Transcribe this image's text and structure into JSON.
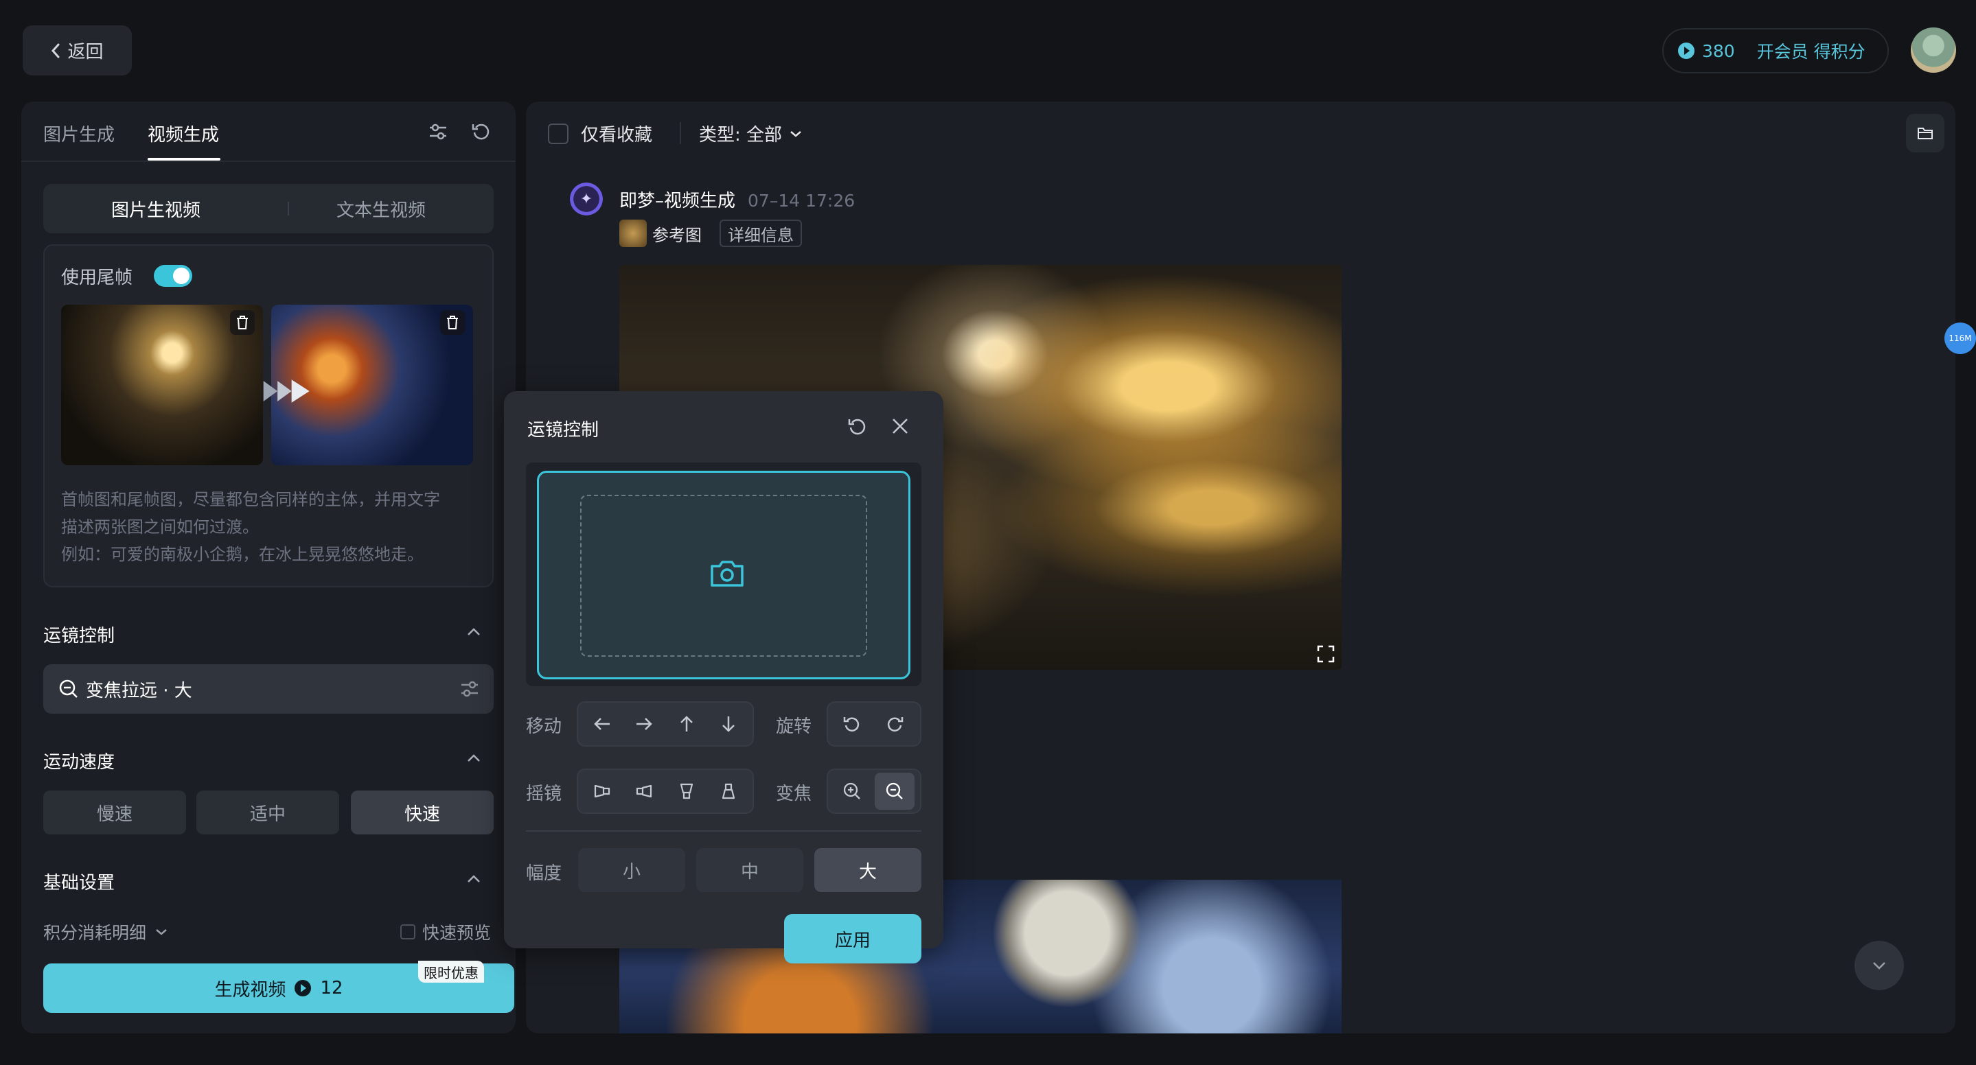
{
  "header": {
    "back_label": "返回",
    "points_value": "380",
    "vip_label": "开会员 得积分"
  },
  "left_panel": {
    "tabs": [
      {
        "label": "图片生成"
      },
      {
        "label": "视频生成"
      }
    ],
    "mode_segments": [
      {
        "label": "图片生视频"
      },
      {
        "label": "文本生视频"
      }
    ],
    "use_last_frame_label": "使用尾帧",
    "use_last_frame_on": true,
    "hint_lines": [
      "首帧图和尾帧图，尽量都包含同样的主体，并用文字",
      "描述两张图之间如何过渡。",
      "例如：可爱的南极小企鹅，在冰上晃晃悠悠地走。"
    ],
    "camera_section_title": "运镜控制",
    "camera_selected": "变焦拉远 · 大",
    "speed_section_title": "运动速度",
    "speed_options": [
      {
        "label": "慢速"
      },
      {
        "label": "适中"
      },
      {
        "label": "快速"
      }
    ],
    "speed_selected": "快速",
    "basic_section_title": "基础设置",
    "cost_detail_label": "积分消耗明细",
    "fast_preview_label": "快速预览",
    "generate_label": "生成视频",
    "generate_cost": "12",
    "promo_label": "限时优惠"
  },
  "right_panel": {
    "favorites_only_label": "仅看收藏",
    "type_filter_label": "类型: 全部",
    "record": {
      "source": "即梦–视频生成",
      "time": "07–14  17:26",
      "ref_label": "参考图",
      "detail_label": "详细信息"
    },
    "side_badge": "116M"
  },
  "camera_popup": {
    "title": "运镜控制",
    "move_label": "移动",
    "rotate_label": "旋转",
    "pan_label": "摇镜",
    "zoom_label": "变焦",
    "amplitude_label": "幅度",
    "amplitude_options": [
      {
        "label": "小"
      },
      {
        "label": "中"
      },
      {
        "label": "大"
      }
    ],
    "amplitude_selected": "大",
    "apply_label": "应用"
  },
  "colors": {
    "accent": "#58cade",
    "background": "#121418",
    "panel": "#1b1e24"
  }
}
